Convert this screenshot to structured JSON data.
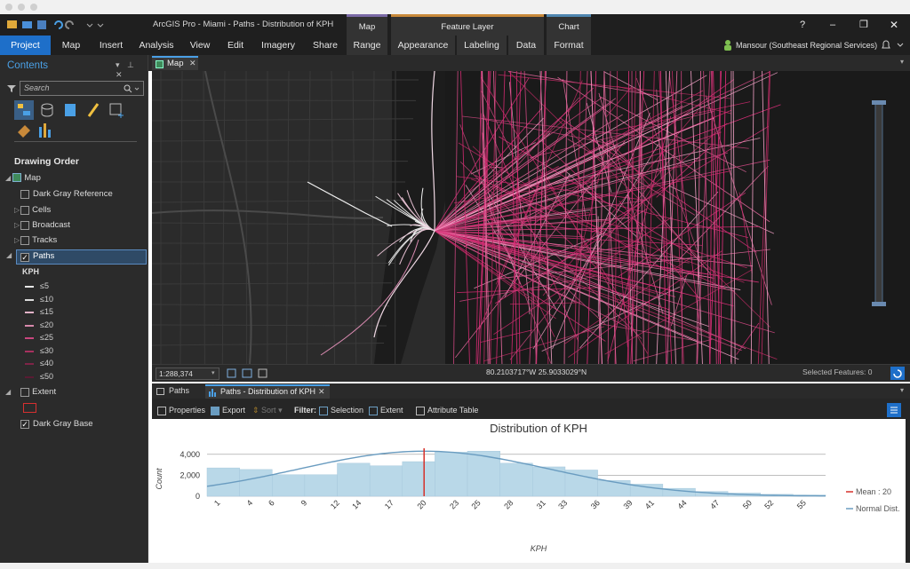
{
  "window": {
    "title": "ArcGIS Pro - Miami - Paths - Distribution of KPH",
    "help": "?",
    "minimize": "–",
    "restore": "❐",
    "close": "✕"
  },
  "context_headers": [
    {
      "label": "Map",
      "color": "#7b6aa6"
    },
    {
      "label": "Feature Layer",
      "color": "#c8893a"
    },
    {
      "label": "Chart",
      "color": "#4f86b0"
    }
  ],
  "ribbon": {
    "tabs": [
      "Project",
      "Map",
      "Insert",
      "Analysis",
      "View",
      "Edit",
      "Imagery",
      "Share",
      "Range",
      "Appearance",
      "Labeling",
      "Data",
      "Format"
    ],
    "active_tab": "Project",
    "user": "Mansour (Southeast Regional Services)"
  },
  "contents": {
    "title": "Contents",
    "search_placeholder": "Search",
    "section": "Drawing Order",
    "map_label": "Map",
    "layers": [
      {
        "label": "Dark Gray Reference",
        "checked": false
      },
      {
        "label": "Cells",
        "checked": false
      },
      {
        "label": "Broadcast",
        "checked": false
      },
      {
        "label": "Tracks",
        "checked": false
      },
      {
        "label": "Paths",
        "checked": true
      }
    ],
    "legend_title": "KPH",
    "legend": [
      {
        "label": "≤5",
        "color": "#e6e6e6"
      },
      {
        "label": "≤10",
        "color": "#dcdcdc"
      },
      {
        "label": "≤15",
        "color": "#e2b2c8"
      },
      {
        "label": "≤20",
        "color": "#d889ac"
      },
      {
        "label": "≤25",
        "color": "#c9467e"
      },
      {
        "label": "≤30",
        "color": "#a8315f"
      },
      {
        "label": "≤40",
        "color": "#7e2447"
      },
      {
        "label": "≤50",
        "color": "#5a1a33"
      }
    ],
    "extent_label": "Extent",
    "base_label": "Dark Gray Base"
  },
  "map": {
    "tab_label": "Map",
    "scale": "1:288,374",
    "coordinates": "80.2103717°W 25.9033029°N",
    "selected": "Selected Features: 0"
  },
  "bottom_tabs": [
    "Paths",
    "Paths - Distribution of KPH"
  ],
  "chart_toolbar": {
    "properties": "Properties",
    "export": "Export",
    "sort": "Sort",
    "filter": "Filter:",
    "selection": "Selection",
    "extent": "Extent",
    "attribute_table": "Attribute Table"
  },
  "colors": {
    "accent": "#1e6fc9",
    "bar_fill": "#b9d8e8",
    "curve": "#6a9cc0",
    "mean": "#d6302a",
    "path_pink": "#e0307c"
  },
  "chart_data": {
    "type": "bar",
    "title": "Distribution of KPH",
    "xlabel": "KPH",
    "ylabel": "Count",
    "ylim": [
      0,
      5000
    ],
    "yticks": [
      0,
      2000,
      4000
    ],
    "ytick_labels": [
      "0",
      "2,000",
      "4,000"
    ],
    "xlim": [
      0,
      57
    ],
    "xticks": [
      1,
      4,
      6,
      9,
      12,
      14,
      17,
      20,
      23,
      25,
      28,
      31,
      33,
      36,
      39,
      41,
      44,
      47,
      50,
      52,
      55
    ],
    "bins": [
      0,
      3,
      6,
      9,
      12,
      15,
      18,
      21,
      24,
      27,
      30,
      33,
      36,
      39,
      42,
      45,
      48,
      51,
      54,
      57
    ],
    "values": [
      2700,
      2550,
      2050,
      2050,
      3150,
      2900,
      3300,
      4200,
      4300,
      3150,
      2800,
      2500,
      1500,
      1150,
      750,
      450,
      300,
      180,
      120
    ],
    "normal_curve": {
      "mean": 20,
      "std": 11.5,
      "peak": 4300
    },
    "mean": 20,
    "legend": [
      {
        "label": "Mean : 20",
        "color": "#d6302a"
      },
      {
        "label": "Normal Dist.",
        "color": "#6a9cc0"
      }
    ],
    "legend_position": "right"
  }
}
